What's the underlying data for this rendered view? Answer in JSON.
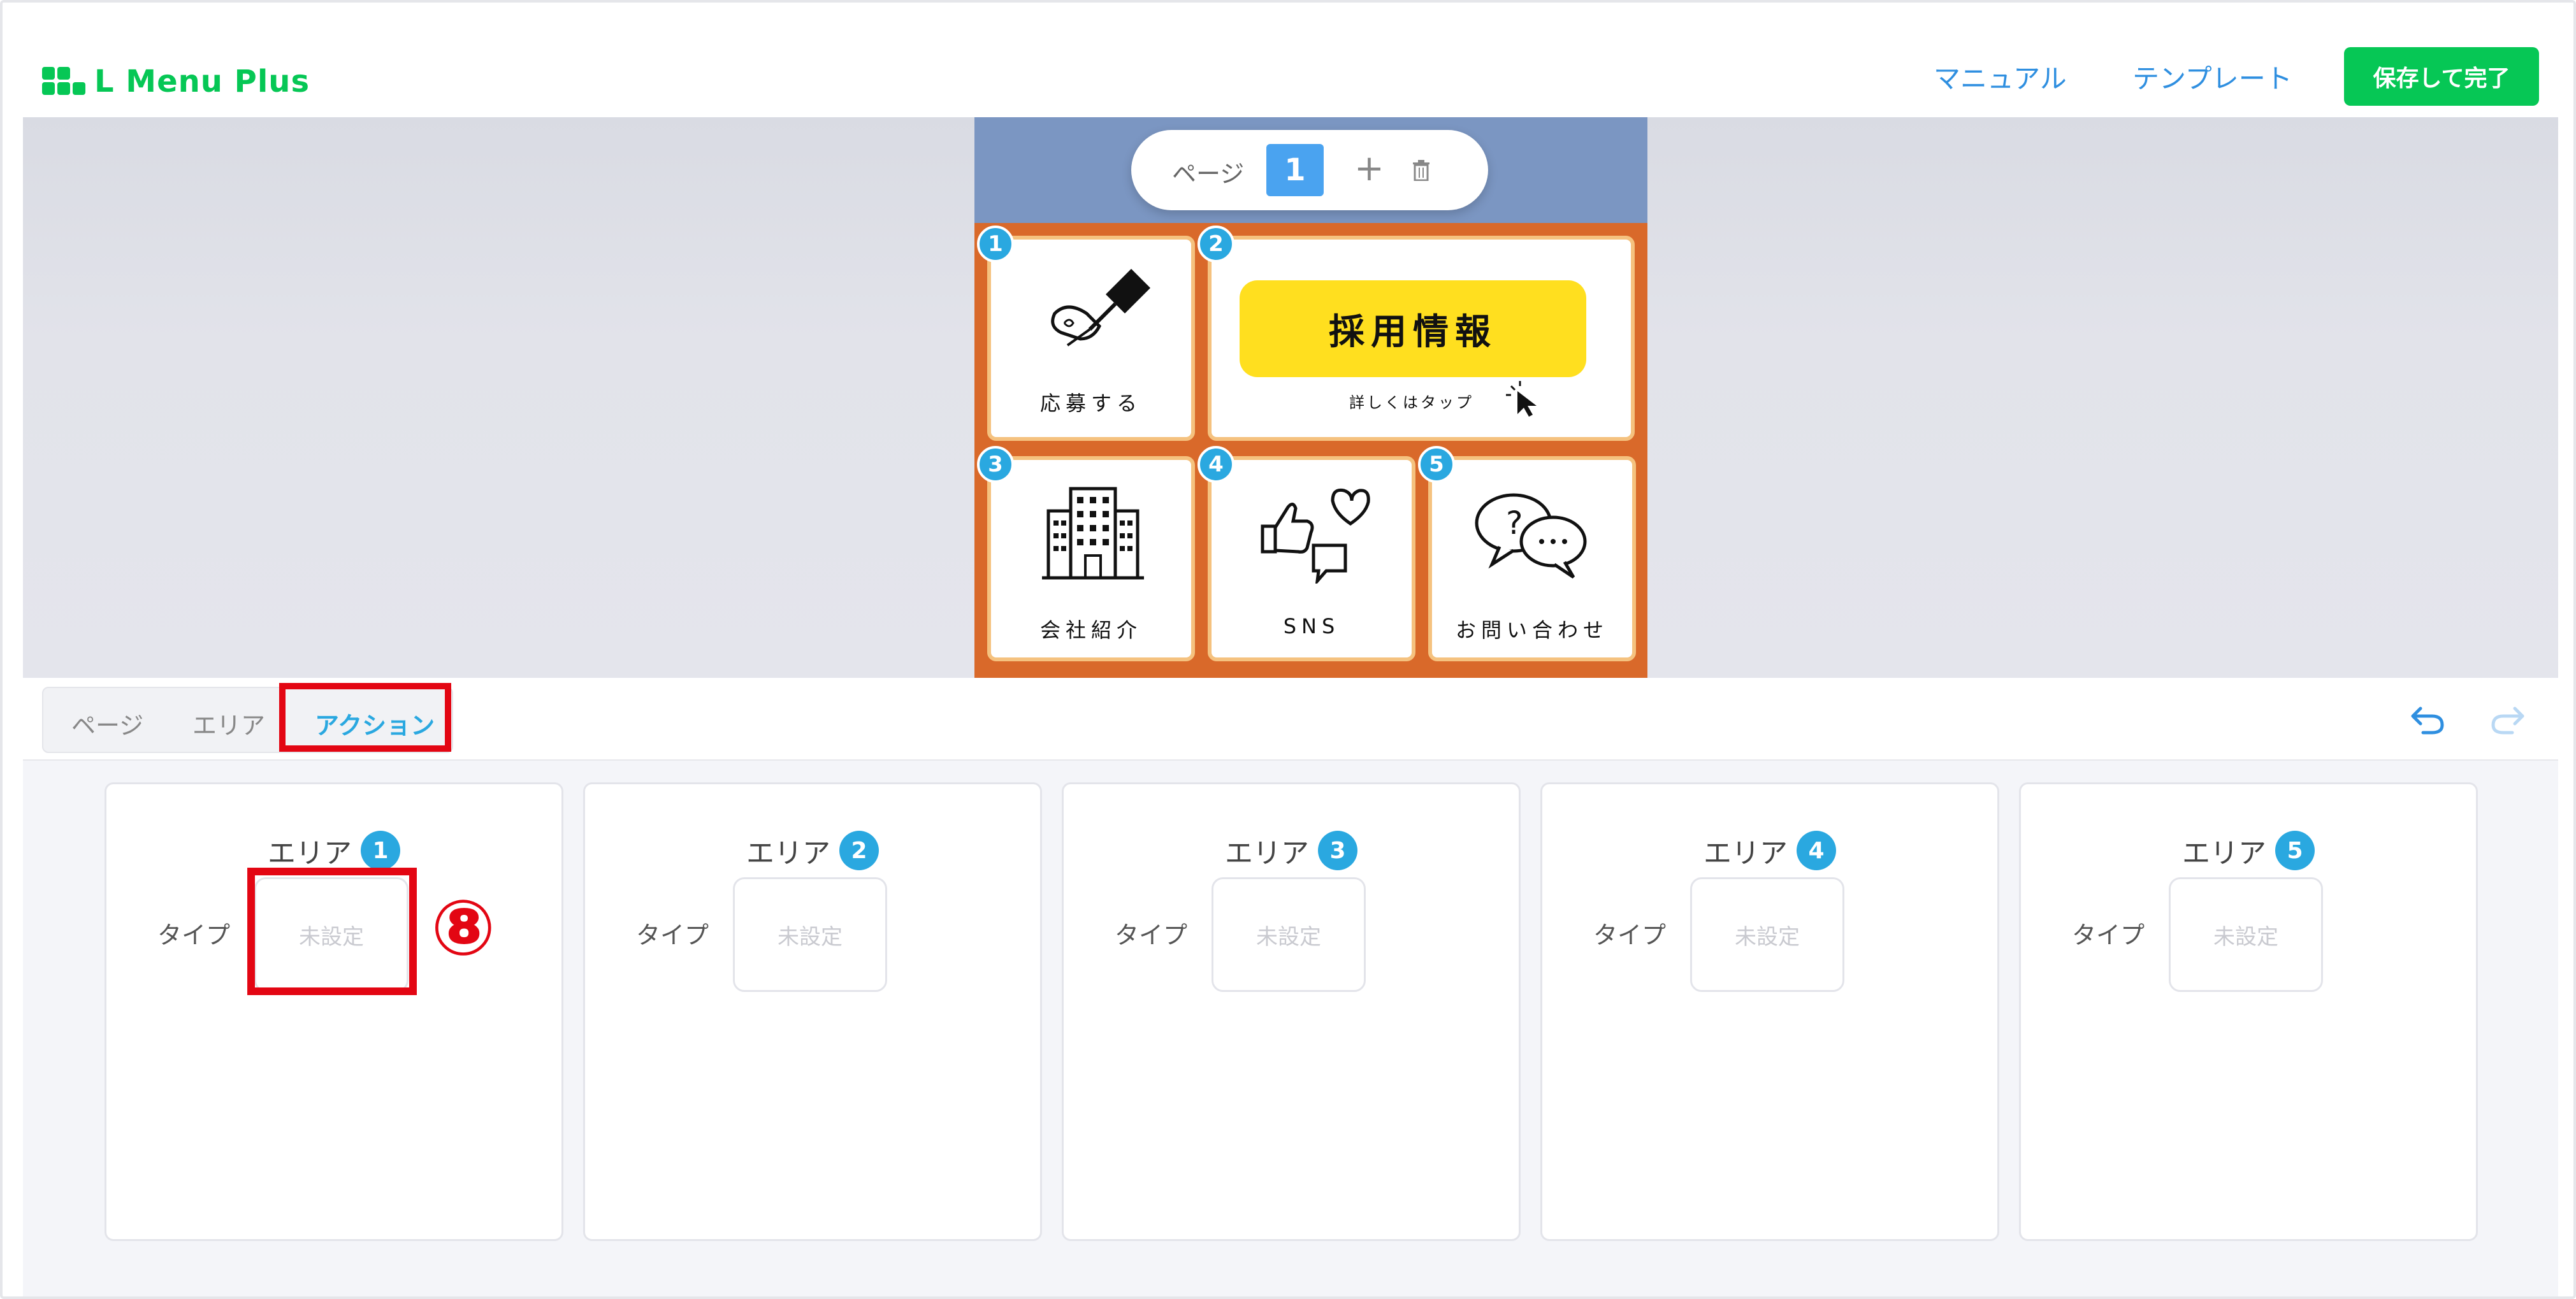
{
  "header": {
    "logo_text": "L Menu Plus",
    "manual_link": "マニュアル",
    "template_link": "テンプレート",
    "save_button": "保存して完了"
  },
  "page_control": {
    "label": "ページ",
    "current_page": "1"
  },
  "menu_tiles": [
    {
      "num": "1",
      "label": "応募する",
      "icon": "pen-signing-icon"
    },
    {
      "num": "2",
      "banner": "採用情報",
      "sub": "詳しくはタップ",
      "icon": "cursor-click-icon"
    },
    {
      "num": "3",
      "label": "会社紹介",
      "icon": "office-building-icon"
    },
    {
      "num": "4",
      "label": "SNS",
      "icon": "thumbs-up-heart-chat-icon"
    },
    {
      "num": "5",
      "label": "お問い合わせ",
      "icon": "speech-bubbles-question-icon"
    }
  ],
  "tabs": {
    "page": "ページ",
    "area": "エリア",
    "action": "アクション",
    "active": "action"
  },
  "action_panel": {
    "areas": [
      {
        "title": "エリア",
        "num": "1",
        "type_label": "タイプ",
        "type_value": "未設定"
      },
      {
        "title": "エリア",
        "num": "2",
        "type_label": "タイプ",
        "type_value": "未設定"
      },
      {
        "title": "エリア",
        "num": "3",
        "type_label": "タイプ",
        "type_value": "未設定"
      },
      {
        "title": "エリア",
        "num": "4",
        "type_label": "タイプ",
        "type_value": "未設定"
      },
      {
        "title": "エリア",
        "num": "5",
        "type_label": "タイプ",
        "type_value": "未設定"
      }
    ]
  },
  "annotation": {
    "step_marker": "⑧",
    "highlight_color": "#e30613"
  },
  "colors": {
    "brand_green": "#06c755",
    "accent_blue": "#2aa8e0",
    "link_blue": "#2f8fe0",
    "menu_background": "#d9692a",
    "banner_yellow": "#ffdf1f"
  }
}
